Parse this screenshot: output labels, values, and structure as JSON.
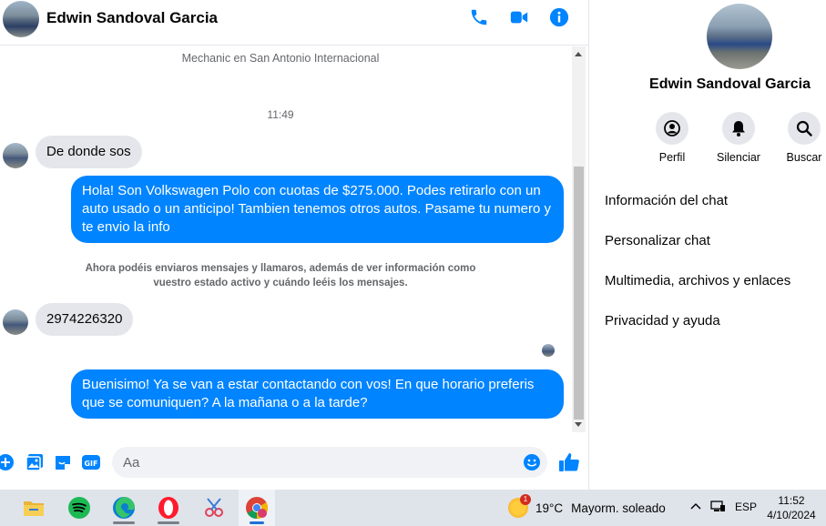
{
  "chat": {
    "contact_name": "Edwin Sandoval Garcia",
    "subtitle": "Mechanic en San Antonio Internacional",
    "timestamp": "11:49",
    "messages": [
      {
        "direction": "in",
        "text": "De donde sos"
      },
      {
        "direction": "out",
        "text": "Hola! Son Volkswagen Polo con cuotas de $275.000. Podes retirarlo con un auto usado o un anticipo! Tambien tenemos otros autos. Pasame tu numero y te envio la info"
      },
      {
        "direction": "notice",
        "line1": "Ahora podéis enviaros mensajes y llamaros, además de ver información como",
        "line2": "vuestro estado activo y cuándo leéis los mensajes."
      },
      {
        "direction": "in",
        "text": "2974226320"
      },
      {
        "direction": "out",
        "text": "Buenisimo! Ya se van a estar contactando con vos! En que horario preferis que se comuniquen? A la mañana o a la tarde?"
      }
    ],
    "composer_placeholder": "Aa",
    "accent": "#0084ff"
  },
  "panel": {
    "name": "Edwin Sandoval Garcia",
    "actions": [
      {
        "label": "Perfil",
        "icon": "profile-icon"
      },
      {
        "label": "Silenciar",
        "icon": "bell-icon"
      },
      {
        "label": "Buscar",
        "icon": "search-icon"
      }
    ],
    "menu": [
      "Información del chat",
      "Personalizar chat",
      "Multimedia, archivos y enlaces",
      "Privacidad y ayuda"
    ]
  },
  "taskbar": {
    "weather_badge": "1",
    "temperature": "19°C",
    "condition": "Mayorm. soleado",
    "language": "ESP",
    "time": "11:52",
    "date": "4/10/2024",
    "apps": [
      "file-explorer-icon",
      "spotify-icon",
      "edge-icon",
      "opera-icon",
      "snipping-tool-icon",
      "chrome-icon"
    ]
  }
}
